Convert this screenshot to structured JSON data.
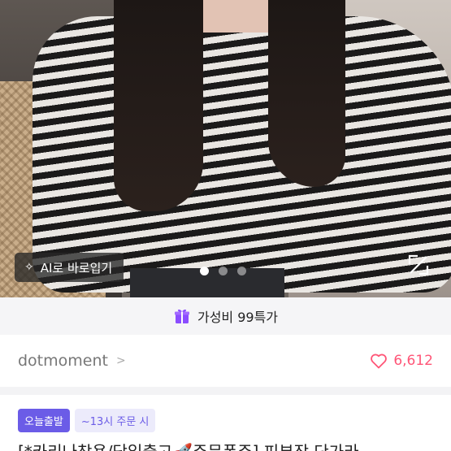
{
  "gallery": {
    "ai_button_label": "AI로 바로입기",
    "ai_icon": "sparkle-icon",
    "dot_count": 3,
    "active_dot": 0
  },
  "promo": {
    "label": "가성비 99특가",
    "icon": "gift-icon",
    "icon_color": "#8b4dff"
  },
  "store": {
    "name": "dotmoment",
    "chevron": ">",
    "like_count": "6,612",
    "like_color": "#ff5577"
  },
  "tags": {
    "primary": "오늘출발",
    "secondary": "~13시 주문 시"
  },
  "product": {
    "title": "[*카리나착용/당일출고🚀주문폭주] 피부장 단가라"
  }
}
